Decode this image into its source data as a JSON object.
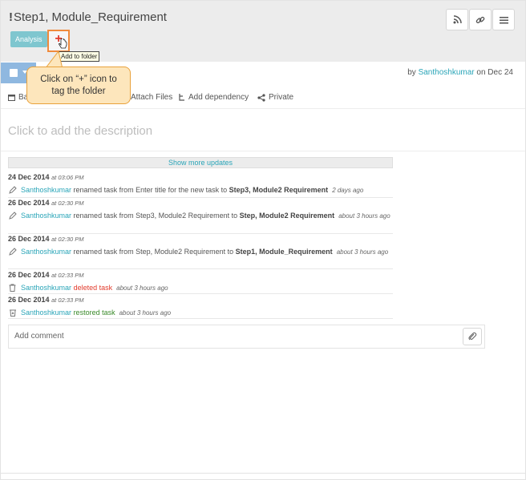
{
  "header": {
    "title": "Step1, Module_Requirement",
    "priority_mark": "!",
    "tag": "Analysis",
    "add_folder_tooltip": "Add to folder",
    "icons": [
      "rss-icon",
      "link-icon",
      "menu-icon"
    ]
  },
  "callout": {
    "line1": "Click on “+” icon to",
    "line2": "tag the folder"
  },
  "taskbar": {
    "by_prefix": "by ",
    "author": "Santhoshkumar",
    "on_text": " on Dec 24"
  },
  "actions": {
    "back_partial": "Ba",
    "attach_files": "Attach Files",
    "add_dependency": "Add dependency",
    "private": "Private"
  },
  "description_placeholder": "Click to add the description",
  "show_more": "Show more updates",
  "activity": [
    {
      "date": "24 Dec 2014",
      "time": "at 03:06 PM",
      "icon": "pencil-icon",
      "user": "Santhoshkumar",
      "text": " renamed task from Enter title for the new task to ",
      "bold": "Step3, Module2 Requirement",
      "when": "2 days ago"
    },
    {
      "date": "26 Dec 2014",
      "time": "at 02:30 PM",
      "icon": "pencil-icon",
      "user": "Santhoshkumar",
      "text": " renamed task from Step3, Module2 Requirement to ",
      "bold": "Step, Module2 Requirement",
      "when": "about 3 hours ago"
    },
    {
      "date": "26 Dec 2014",
      "time": "at 02:30 PM",
      "icon": "pencil-icon",
      "user": "Santhoshkumar",
      "text": " renamed task from Step, Module2 Requirement to ",
      "bold": "Step1, Module_Requirement",
      "when": "about 3 hours ago"
    },
    {
      "date": "26 Dec 2014",
      "time": "at 02:33 PM",
      "icon": "trash-icon",
      "user": "Santhoshkumar",
      "action": "deleted task",
      "when": "about 3 hours ago"
    },
    {
      "date": "26 Dec 2014",
      "time": "at 02:33 PM",
      "icon": "restore-icon",
      "user": "Santhoshkumar",
      "action": "restored task",
      "when": "about 3 hours ago"
    }
  ],
  "comment": {
    "placeholder": "Add comment"
  }
}
